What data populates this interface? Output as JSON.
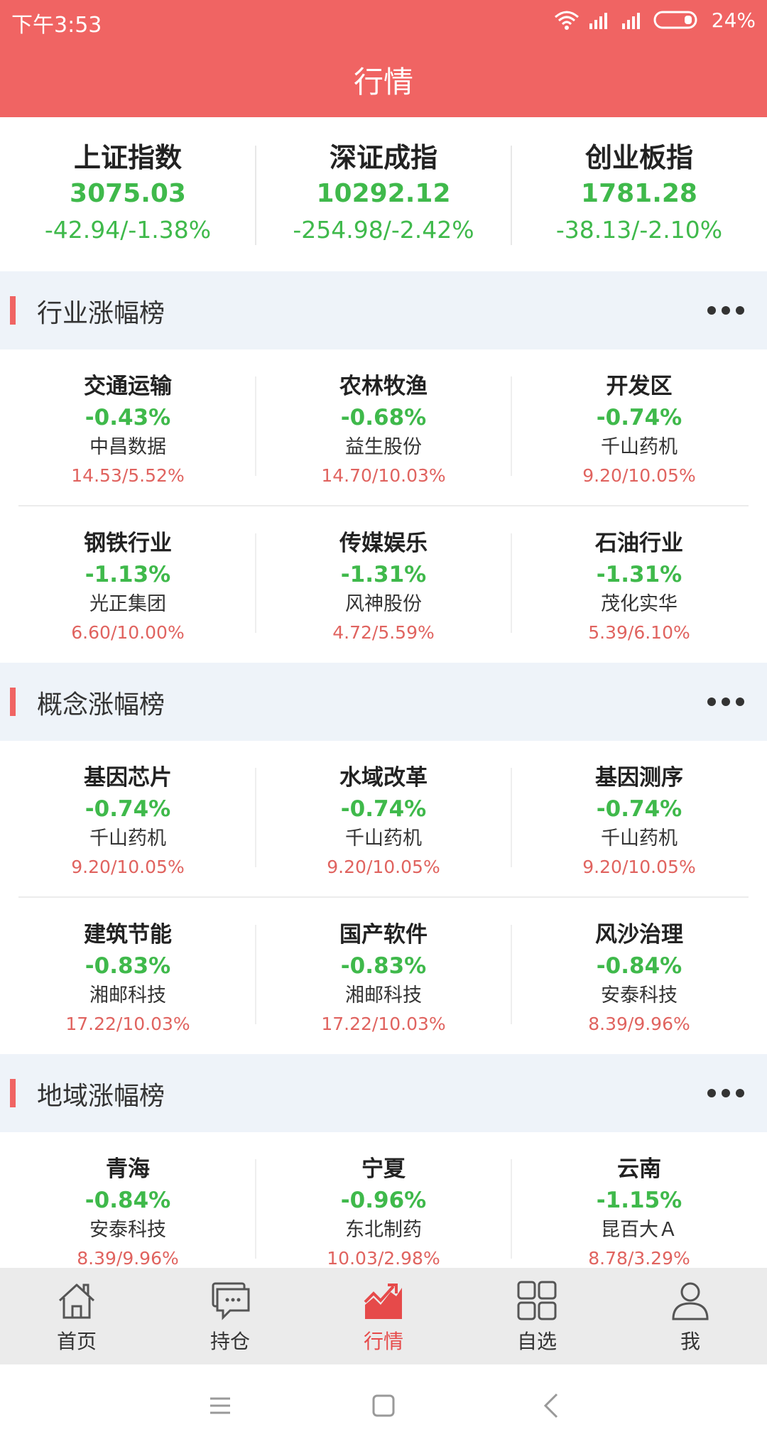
{
  "status_bar": {
    "time": "下午3:53",
    "battery": "24%"
  },
  "header": {
    "title": "行情"
  },
  "indices": [
    {
      "name": "上证指数",
      "value": "3075.03",
      "change": "-42.94/-1.38%"
    },
    {
      "name": "深证成指",
      "value": "10292.12",
      "change": "-254.98/-2.42%"
    },
    {
      "name": "创业板指",
      "value": "1781.28",
      "change": "-38.13/-2.10%"
    }
  ],
  "sections": [
    {
      "title": "行业涨幅榜",
      "items": [
        {
          "name": "交通运输",
          "change": "-0.43%",
          "stock": "中昌数据",
          "price": "14.53/5.52%"
        },
        {
          "name": "农林牧渔",
          "change": "-0.68%",
          "stock": "益生股份",
          "price": "14.70/10.03%"
        },
        {
          "name": "开发区",
          "change": "-0.74%",
          "stock": "千山药机",
          "price": "9.20/10.05%"
        },
        {
          "name": "钢铁行业",
          "change": "-1.13%",
          "stock": "光正集团",
          "price": "6.60/10.00%"
        },
        {
          "name": "传媒娱乐",
          "change": "-1.31%",
          "stock": "风神股份",
          "price": "4.72/5.59%"
        },
        {
          "name": "石油行业",
          "change": "-1.31%",
          "stock": "茂化实华",
          "price": "5.39/6.10%"
        }
      ]
    },
    {
      "title": "概念涨幅榜",
      "items": [
        {
          "name": "基因芯片",
          "change": "-0.74%",
          "stock": "千山药机",
          "price": "9.20/10.05%"
        },
        {
          "name": "水域改革",
          "change": "-0.74%",
          "stock": "千山药机",
          "price": "9.20/10.05%"
        },
        {
          "name": "基因测序",
          "change": "-0.74%",
          "stock": "千山药机",
          "price": "9.20/10.05%"
        },
        {
          "name": "建筑节能",
          "change": "-0.83%",
          "stock": "湘邮科技",
          "price": "17.22/10.03%"
        },
        {
          "name": "国产软件",
          "change": "-0.83%",
          "stock": "湘邮科技",
          "price": "17.22/10.03%"
        },
        {
          "name": "风沙治理",
          "change": "-0.84%",
          "stock": "安泰科技",
          "price": "8.39/9.96%"
        }
      ]
    },
    {
      "title": "地域涨幅榜",
      "items": [
        {
          "name": "青海",
          "change": "-0.84%",
          "stock": "安泰科技",
          "price": "8.39/9.96%"
        },
        {
          "name": "宁夏",
          "change": "-0.96%",
          "stock": "东北制药",
          "price": "10.03/2.98%"
        },
        {
          "name": "云南",
          "change": "-1.15%",
          "stock": "昆百大Ａ",
          "price": "8.78/3.29%"
        }
      ]
    }
  ],
  "bottom_nav": [
    {
      "label": "首页",
      "icon": "home-icon"
    },
    {
      "label": "持仓",
      "icon": "chat-icon"
    },
    {
      "label": "行情",
      "icon": "market-chart-icon",
      "active": true
    },
    {
      "label": "自选",
      "icon": "grid-icon"
    },
    {
      "label": "我",
      "icon": "user-icon"
    }
  ],
  "colors": {
    "brand": "#f06463",
    "down": "#3fb94b",
    "price": "#e0635f",
    "section_bg": "#eef3f9"
  }
}
